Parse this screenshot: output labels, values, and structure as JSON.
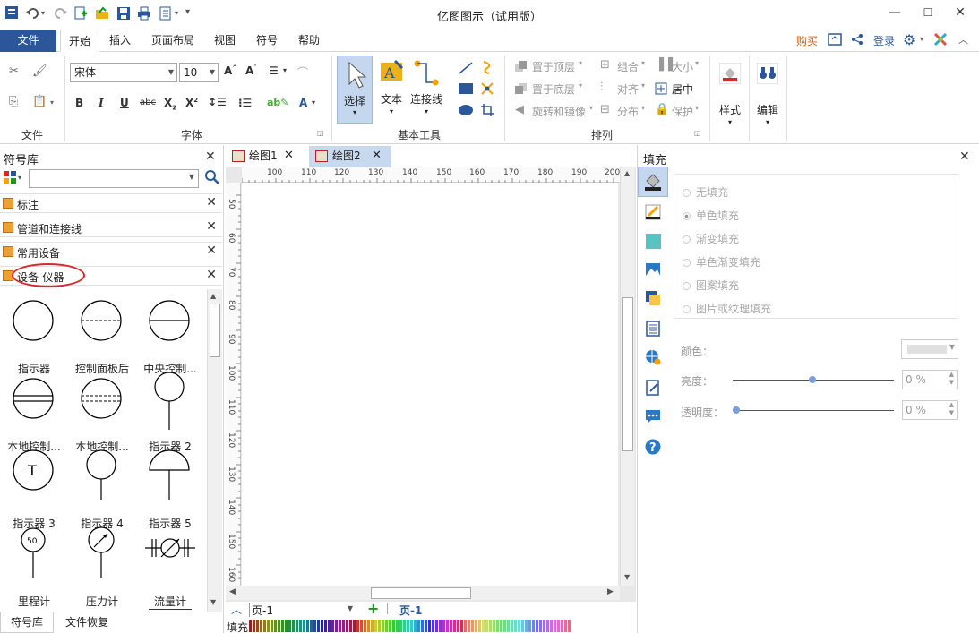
{
  "window": {
    "title": "亿图图示（试用版）",
    "controls": {
      "minimize": "—",
      "maximize": "☐",
      "close": "✕"
    }
  },
  "menu": {
    "file": "文件",
    "tabs": [
      "开始",
      "插入",
      "页面布局",
      "视图",
      "符号",
      "帮助"
    ],
    "right": {
      "buy": "购买",
      "login": "登录"
    }
  },
  "ribbon": {
    "groups": {
      "file": "文件",
      "font": "字体",
      "basic_tools": "基本工具",
      "arrange": "排列"
    },
    "font_name": "宋体",
    "font_size": "10",
    "tools": {
      "select": "选择",
      "text": "文本",
      "connector": "连接线"
    },
    "arrange_items": [
      "置于顶层",
      "置于底层",
      "旋转和镜像",
      "组合",
      "对齐",
      "分布",
      "大小",
      "居中",
      "保护"
    ],
    "style": "样式",
    "edit": "编辑"
  },
  "library": {
    "title": "符号库",
    "search_placeholder": "",
    "categories": [
      "标注",
      "管道和连接线",
      "常用设备",
      "设备-仪器"
    ],
    "symbols": [
      "指示器",
      "控制面板后",
      "中央控制...",
      "本地控制...",
      "本地控制...",
      "指示器 2",
      "指示器 3",
      "指示器 4",
      "指示器 5",
      "里程计",
      "压力计",
      "流量计"
    ],
    "odometer_value": "50",
    "tabs": [
      "符号库",
      "文件恢复"
    ]
  },
  "document": {
    "tabs": [
      "绘图1",
      "绘图2"
    ],
    "hruler": [
      "100",
      "110",
      "120",
      "130",
      "140",
      "150",
      "160",
      "170",
      "180",
      "190",
      "200"
    ],
    "vruler": [
      "50",
      "60",
      "70",
      "80",
      "90",
      "100",
      "110",
      "120",
      "130",
      "140",
      "150",
      "160"
    ],
    "page_select": "页-1",
    "page_tab": "页-1"
  },
  "fill": {
    "title": "填充",
    "options": [
      "无填充",
      "单色填充",
      "渐变填充",
      "单色渐变填充",
      "图案填充",
      "图片或纹理填充"
    ],
    "color_label": "颜色：",
    "brightness_label": "亮度：",
    "brightness_value": "0 %",
    "transparency_label": "透明度：",
    "transparency_value": "0 %"
  },
  "palette_label": "填充",
  "colors": {
    "accent": "#2b579a",
    "annotation": "#d9262b",
    "buy": "#e05a00"
  }
}
